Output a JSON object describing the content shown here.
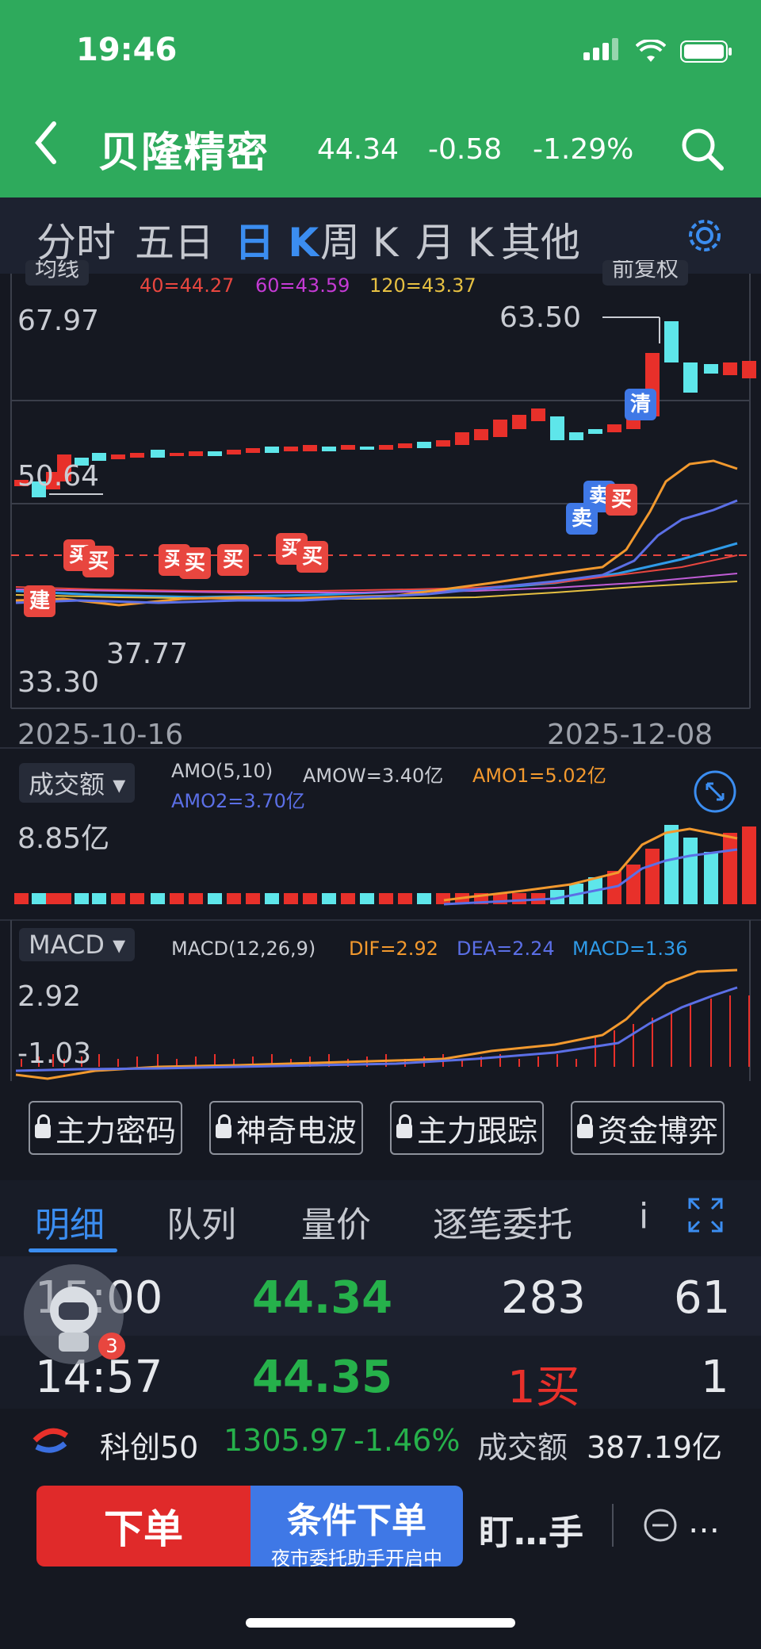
{
  "status": {
    "time": "19:46"
  },
  "header": {
    "stock_name": "贝隆精密",
    "price": "44.34",
    "change": "-0.58",
    "change_pct": "-1.29%"
  },
  "period_tabs": [
    "分时",
    "五日",
    "日 K",
    "周 K",
    "月 K",
    "其他"
  ],
  "active_period": "日 K",
  "chart": {
    "ma_chip": "均线",
    "ma_values": {
      "ma40": "40=44.27",
      "ma60": "60=43.59",
      "ma120": "120=43.37"
    },
    "adjust_chip": "前复权",
    "price_labels": {
      "high_axis": "67.97",
      "mid_axis": "50.64",
      "low_axis": "33.30",
      "peak": "63.50",
      "trough": "37.77"
    },
    "date_start": "2025-10-16",
    "date_end": "2025-12-08",
    "trade_tags": {
      "build": "建",
      "buy": "买",
      "sell": "卖",
      "clear": "清"
    },
    "colors": {
      "up": "#e8302a",
      "down": "#5ee6ea",
      "ma_orange": "#f2992e",
      "ma_blue": "#5b6fe6",
      "ma_cyan": "#2f9be8",
      "dashed_ref": "#e8463f"
    }
  },
  "volume": {
    "chip": "成交额",
    "label_amo": "AMO(5,10)",
    "amow": "AMOW=3.40亿",
    "amo1": "AMO1=5.02亿",
    "amo2": "AMO2=3.70亿",
    "max_label": "8.85亿"
  },
  "macd": {
    "chip": "MACD",
    "label": "MACD(12,26,9)",
    "dif": "DIF=2.92",
    "dea": "DEA=2.24",
    "macd_val": "MACD=1.36",
    "top_label": "2.92",
    "low_label": "-1.03"
  },
  "features": [
    "主力密码",
    "神奇电波",
    "主力跟踪",
    "资金博弈"
  ],
  "detail_tabs": [
    "明细",
    "队列",
    "量价",
    "逐笔委托",
    "i"
  ],
  "trades": [
    {
      "time": "15:00",
      "price": "44.34",
      "vol": "283",
      "count": "61"
    },
    {
      "time": "14:57",
      "price": "44.35",
      "vol": "1买",
      "count": "1"
    }
  ],
  "float_badge": "3",
  "index_bar": {
    "name": "科创50",
    "value": "1305.97",
    "pct": "-1.46%",
    "amount_label": "成交额",
    "amount": "387.19亿"
  },
  "order_bar": {
    "order": "下单",
    "cond": "条件下单",
    "cond_sub": "夜市委托助手开启中",
    "watch": "盯…手",
    "more": "…"
  }
}
